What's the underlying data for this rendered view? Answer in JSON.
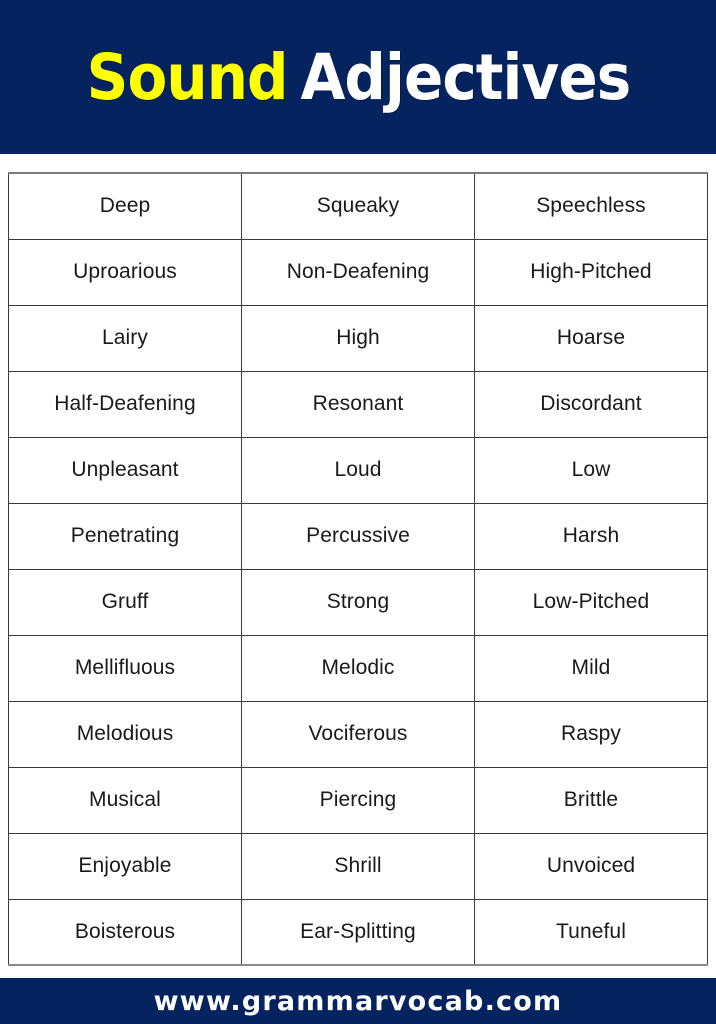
{
  "header": {
    "background_color": "#05245f",
    "title_part_1": "Sound",
    "title_part_1_color": "#ffff00",
    "title_part_2": "Adjectives",
    "title_part_2_color": "#ffffff"
  },
  "table": {
    "columns": 3,
    "rows": [
      [
        "Deep",
        "Squeaky",
        "Speechless"
      ],
      [
        "Uproarious",
        "Non-Deafening",
        "High-Pitched"
      ],
      [
        "Lairy",
        "High",
        "Hoarse"
      ],
      [
        "Half-Deafening",
        "Resonant",
        "Discordant"
      ],
      [
        "Unpleasant",
        "Loud",
        "Low"
      ],
      [
        "Penetrating",
        "Percussive",
        "Harsh"
      ],
      [
        "Gruff",
        "Strong",
        "Low-Pitched"
      ],
      [
        "Mellifluous",
        "Melodic",
        "Mild"
      ],
      [
        "Melodious",
        "Vociferous",
        "Raspy"
      ],
      [
        "Musical",
        "Piercing",
        "Brittle"
      ],
      [
        "Enjoyable",
        "Shrill",
        "Unvoiced"
      ],
      [
        "Boisterous",
        "Ear-Splitting",
        "Tuneful"
      ]
    ]
  },
  "footer": {
    "background_color": "#05245f",
    "url": "www.grammarvocab.com",
    "url_color": "#ffffff"
  }
}
